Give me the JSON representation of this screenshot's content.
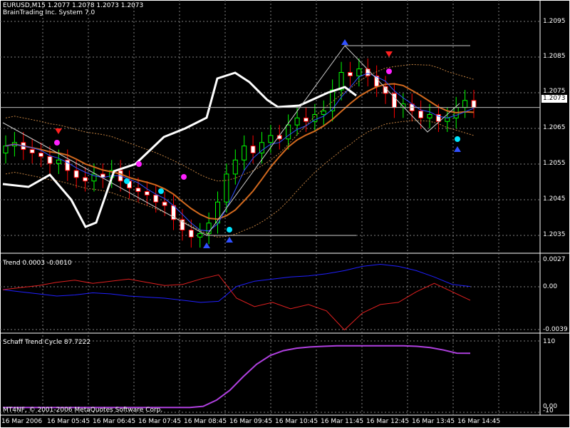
{
  "header": {
    "symbol_line": "EURUSD,M15  1.2077 1.2078 1.2073 1.2073",
    "system_line": "BrainTrading Inc. System 7.0"
  },
  "price_axis": {
    "ticks": [
      "1.2095",
      "1.2085",
      "1.2075",
      "1.2065",
      "1.2055",
      "1.2045",
      "1.2035"
    ],
    "current": "1.2073"
  },
  "trend_panel": {
    "title": "Trend 0.0003 -0.0010",
    "ticks": [
      "0.0027",
      "0.00",
      "-0.0039"
    ]
  },
  "stc_panel": {
    "title": "Schaff Trend Cycle 87.7222",
    "ticks": [
      "110",
      "0.00",
      "-10"
    ]
  },
  "copyright": "MT4NF, © 2001-2006 MetaQuotes Software Corp.",
  "time_axis": [
    "16 Mar 2006",
    "16 Mar 05:45",
    "16 Mar 06:45",
    "16 Mar 07:45",
    "16 Mar 08:45",
    "16 Mar 09:45",
    "16 Mar 10:45",
    "16 Mar 11:45",
    "16 Mar 12:45",
    "16 Mar 13:45",
    "16 Mar 14:45"
  ],
  "colors": {
    "background": "#000000",
    "grid": "#808080",
    "bull_candle": "#00ff00",
    "bear_candle": "#ff0000",
    "trend_up_line": "#2020ff",
    "trend_down_line": "#e02020",
    "stc_line": "#b040e0",
    "signal_up": "#00e5ff",
    "signal_down": "#ff20ff"
  },
  "chart_data": [
    {
      "type": "candlestick",
      "title": "EURUSD,M15",
      "y_range": [
        1.2032,
        1.21
      ],
      "close_series": [
        1.2062,
        1.2063,
        1.2061,
        1.206,
        1.2059,
        1.2057,
        1.2058,
        1.2055,
        1.2053,
        1.2052,
        1.2054,
        1.2053,
        1.2055,
        1.2052,
        1.205,
        1.2049,
        1.2048,
        1.2046,
        1.2045,
        1.2041,
        1.2038,
        1.2036,
        1.2037,
        1.204,
        1.2046,
        1.2054,
        1.2058,
        1.2062,
        1.206,
        1.2063,
        1.2065,
        1.2064,
        1.2068,
        1.207,
        1.2069,
        1.2071,
        1.2072,
        1.2078,
        1.2083,
        1.2082,
        1.2084,
        1.2082,
        1.2079,
        1.2077,
        1.2073,
        1.2074,
        1.2072,
        1.207,
        1.2071,
        1.2069,
        1.207,
        1.2073,
        1.2075,
        1.2073
      ]
    },
    {
      "type": "line",
      "title": "Trend 0.0003 -0.0010",
      "series": [
        {
          "values": [
            0.0,
            -0.0002,
            -0.0004,
            -0.0006,
            -0.0005,
            -0.0003,
            -0.0004,
            -0.0006,
            -0.0007,
            -0.0008,
            -0.001,
            -0.0012,
            -0.0011,
            0.0003,
            0.0008,
            0.001,
            0.0012,
            0.0013,
            0.0015,
            0.0018,
            0.0022,
            0.0024,
            0.0022,
            0.0018,
            0.0012,
            0.0005,
            0.0003
          ]
        },
        {
          "values": [
            0.0,
            0.0002,
            0.0004,
            0.0007,
            0.0009,
            0.0006,
            0.0008,
            0.001,
            0.0007,
            0.0004,
            0.0005,
            0.001,
            0.0014,
            -0.0008,
            -0.0016,
            -0.0012,
            -0.0018,
            -0.0014,
            -0.002,
            -0.0038,
            -0.0022,
            -0.0014,
            -0.0012,
            -0.0002,
            0.0006,
            -0.0002,
            -0.001
          ]
        }
      ],
      "ylim": [
        -0.0039,
        0.0027
      ]
    },
    {
      "type": "line",
      "title": "Schaff Trend Cycle 87.7222",
      "series": [
        {
          "values": [
            0,
            0,
            0,
            0,
            0,
            0,
            0,
            0,
            0,
            0,
            0,
            0,
            0,
            0,
            0,
            2,
            12,
            28,
            50,
            70,
            84,
            92,
            96,
            98,
            99,
            100,
            100,
            100,
            100,
            100,
            100,
            99,
            97,
            93,
            88,
            87.7
          ]
        }
      ],
      "ylim": [
        -10,
        110
      ]
    }
  ]
}
